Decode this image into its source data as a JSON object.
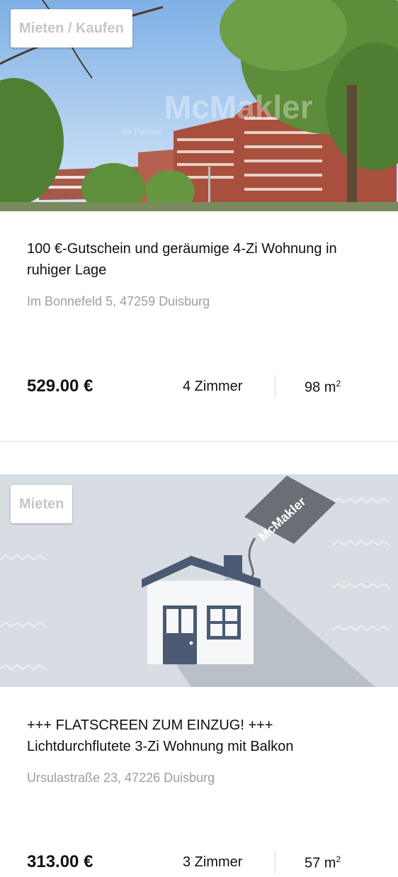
{
  "listings": [
    {
      "badge": "Mieten / Kaufen",
      "title": "100 €-Gutschein und geräumige 4-Zi Wohnung in ruhiger Lage",
      "address": "Im Bonnefeld 5, 47259 Duisburg",
      "price": "529.00 €",
      "rooms": "4 Zimmer",
      "area_value": "98 m",
      "area_unit_sup": "2",
      "image_watermark": "McMakler",
      "image_watermark_sub": "Ihr Partner"
    },
    {
      "badge": "Mieten",
      "title": "+++ FLATSCREEN ZUM EINZUG! +++ Lichtdurchflutete 3-Zi Wohnung mit Balkon",
      "address": "Ursulastraße 23, 47226 Duisburg",
      "price": "313.00 €",
      "rooms": "3 Zimmer",
      "area_value": "57 m",
      "area_unit_sup": "2",
      "tag_text": "McMakler"
    }
  ],
  "colors": {
    "badge_text": "#c6c6c6",
    "address_text": "#9e9e9e",
    "placeholder_bg": "#d8dde3",
    "house_roof": "#4a5a72"
  }
}
